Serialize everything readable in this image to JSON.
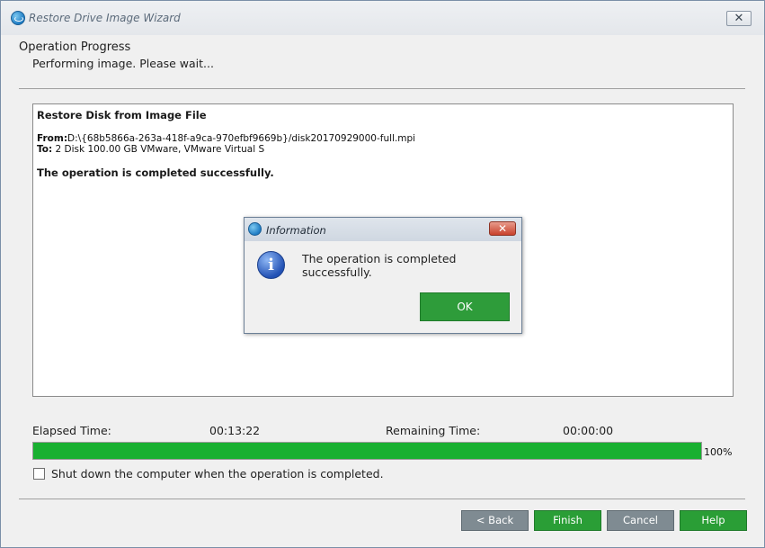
{
  "window": {
    "title": "Restore Drive Image Wizard",
    "close_glyph": "✕"
  },
  "header": {
    "title": "Operation Progress",
    "subtitle": "Performing image. Please wait..."
  },
  "log": {
    "title": "Restore Disk from Image File",
    "from_label": "From:",
    "from_value": "D:\\{68b5866a-263a-418f-a9ca-970efbf9669b}/disk20170929000-full.mpi",
    "to_label": "To:",
    "to_value": "2 Disk 100.00 GB VMware, VMware Virtual S",
    "status": "The operation is completed successfully."
  },
  "dialog": {
    "title": "Information",
    "message": "The operation is completed successfully.",
    "ok_label": "OK",
    "close_glyph": "✕",
    "info_glyph": "i"
  },
  "progress": {
    "elapsed_label": "Elapsed Time:",
    "elapsed_value": "00:13:22",
    "remaining_label": "Remaining Time:",
    "remaining_value": "00:00:00",
    "percent_text": "100%",
    "fraction": 1.0,
    "bar_color": "#18b030"
  },
  "options": {
    "shutdown_label": "Shut down the computer when the operation is completed.",
    "shutdown_checked": false
  },
  "footer": {
    "back_label": "< Back",
    "finish_label": "Finish",
    "cancel_label": "Cancel",
    "help_label": "Help"
  },
  "colors": {
    "accent_green": "#2a9e36",
    "disabled_gray": "#7f8b92"
  }
}
